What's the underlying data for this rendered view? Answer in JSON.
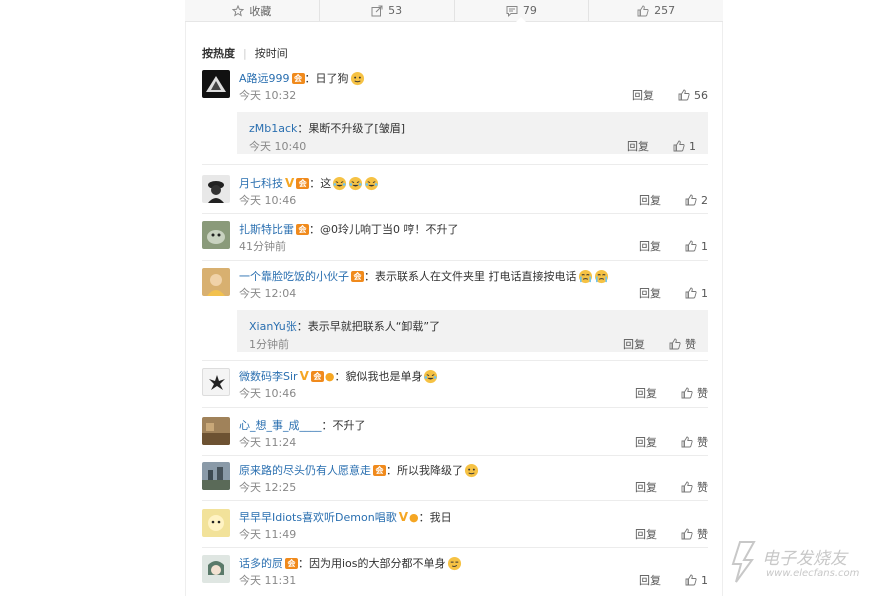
{
  "action_bar": {
    "items": [
      {
        "label": "收藏",
        "icon": "star-icon"
      },
      {
        "label": "53",
        "icon": "share-icon"
      },
      {
        "label": "79",
        "icon": "comment-icon"
      },
      {
        "label": "257",
        "icon": "thumbs-up-icon"
      }
    ]
  },
  "sort": {
    "hot": "按热度",
    "time": "按时间",
    "separator": "|"
  },
  "comments": [
    {
      "user": "A路远999",
      "text": "：日了狗",
      "time": "今天 10:32",
      "reply": "回复",
      "likes": "56"
    },
    {
      "user": "月七科技",
      "text": "：这",
      "time": "今天 10:46",
      "reply": "回复",
      "likes": "2"
    },
    {
      "user": "扎斯特比雷",
      "text": "：@0玲儿响丁当0 哼！不升了",
      "time": "41分钟前",
      "reply": "回复",
      "likes": "1"
    },
    {
      "user": "一个靠脸吃饭的小伙子",
      "text": "：表示联系人在文件夹里 打电话直接按电话",
      "time": "今天 12:04",
      "reply": "回复",
      "likes": "1"
    },
    {
      "user": "微数码李Sir",
      "text": "：貌似我也是单身",
      "time": "今天 10:46",
      "reply": "回复",
      "likes": "赞"
    },
    {
      "user": "心_想_事_成____",
      "text": "：不升了",
      "time": "今天 11:24",
      "reply": "回复",
      "likes": "赞"
    },
    {
      "user": "原来路的尽头仍有人愿意走",
      "text": "：所以我降级了",
      "time": "今天 12:25",
      "reply": "回复",
      "likes": "赞"
    },
    {
      "user": "早早早Idiots喜欢听Demon唱歌",
      "text": "：我日",
      "time": "今天 11:49",
      "reply": "回复",
      "likes": "赞"
    },
    {
      "user": "话多的屃",
      "text": "：因为用ios的大部分都不单身",
      "time": "今天 11:31",
      "reply": "回复",
      "likes": "1"
    }
  ],
  "replies": [
    {
      "user": "zMb1ack",
      "text": "：果断不升级了[皱眉]",
      "time": "今天 10:40",
      "reply": "回复",
      "likes": "1"
    },
    {
      "user": "XianYu张",
      "text": "：表示早就把联系人“卸载”了",
      "time": "1分钟前",
      "reply": "回复",
      "likes": "赞"
    }
  ],
  "badges": {
    "vip": "会",
    "verified": "V"
  },
  "watermark": {
    "cn": "电子发烧友",
    "en": "www.elecfans.com"
  },
  "colors": {
    "username": "#2a6fb0",
    "meta": "#888888",
    "reply_bg": "#f2f2f2",
    "vip": "#f08a1c",
    "verified": "#f5a623"
  }
}
